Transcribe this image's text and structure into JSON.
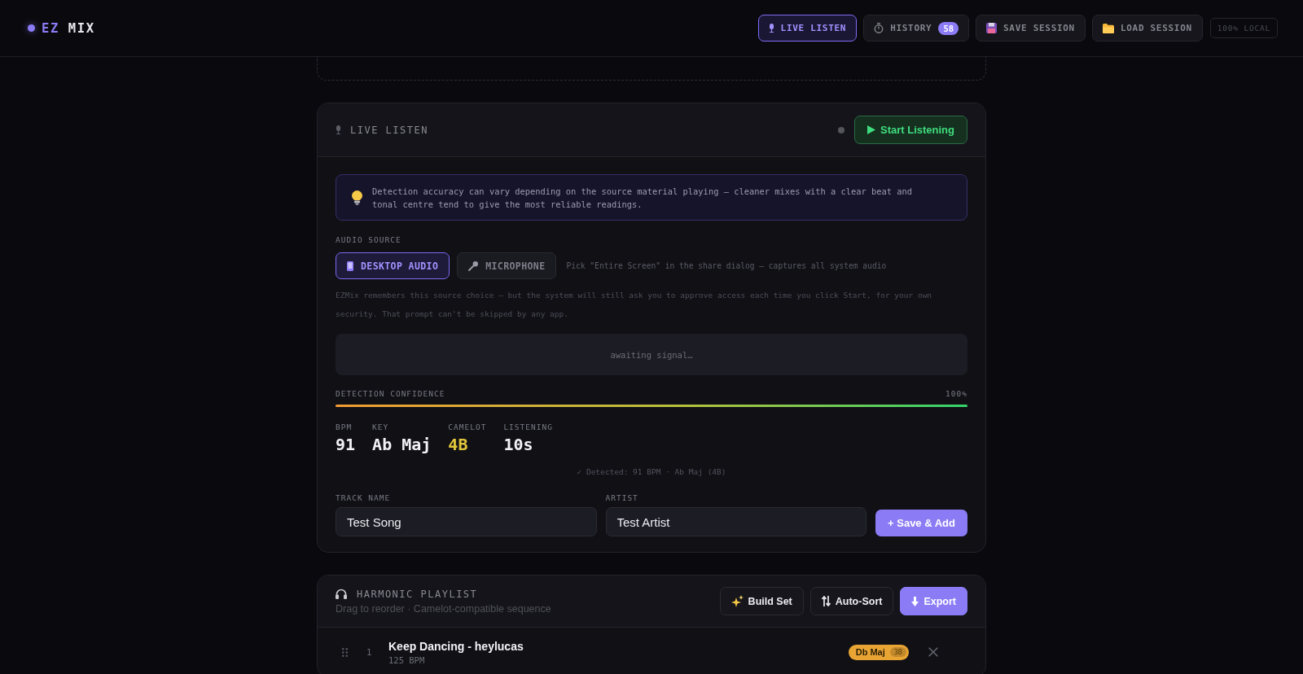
{
  "header": {
    "logo": [
      "EZ",
      "MIX"
    ],
    "nav": [
      {
        "label": "LIVE LISTEN",
        "selected": true
      },
      {
        "label": "HISTORY",
        "badge": "58",
        "selected": false
      },
      {
        "label": "SAVE SESSION",
        "selected": false
      },
      {
        "label": "LOAD SESSION",
        "selected": false
      }
    ],
    "status_chip": "100% LOCAL"
  },
  "live_listen": {
    "title": "LIVE LISTEN",
    "listening": false,
    "start_button": "Start Listening",
    "tip": "Detection accuracy can vary depending on the source material playing — cleaner mixes with a clear beat and tonal centre tend to give the most reliable readings.",
    "audio_source": {
      "label": "AUDIO SOURCE",
      "options": [
        {
          "label": "DESKTOP AUDIO",
          "selected": true
        },
        {
          "label": "MICROPHONE",
          "selected": false
        }
      ],
      "hint": "Pick \"Entire Screen\" in the share dialog — captures all system audio"
    },
    "note": "EZMix remembers this source choice — but the system will still ask you to approve access each time you click Start, for your own security. That prompt can't be skipped by any app.",
    "signal": "awaiting signal…",
    "confidence": {
      "label": "DETECTION CONFIDENCE",
      "reading": "100%",
      "level": 1
    },
    "stats": [
      {
        "label": "BPM",
        "value": "91",
        "highlighted": false
      },
      {
        "label": "KEY",
        "value": "Ab Maj",
        "highlighted": false
      },
      {
        "label": "CAMELOT",
        "value": "4B",
        "highlighted": true
      },
      {
        "label": "LISTENING",
        "value": "10s",
        "highlighted": false
      }
    ],
    "detected": "✓ Detected: 91 BPM · Ab Maj (4B)",
    "fields": [
      {
        "label": "TRACK NAME",
        "value": "Test Song"
      },
      {
        "label": "ARTIST",
        "value": "Test Artist"
      }
    ],
    "submit_button": "+ Save & Add"
  },
  "playlist": {
    "title": "HARMONIC PLAYLIST",
    "subtitle": "Drag to reorder · Camelot-compatible sequence",
    "actions": [
      {
        "label": "Build Set",
        "primary": false
      },
      {
        "label": "Auto-Sort",
        "primary": false
      },
      {
        "label": "Export",
        "primary": true
      }
    ],
    "tracks": [
      {
        "number": "1",
        "title": "Keep Dancing - heylucas",
        "bpm": "125 BPM",
        "key": "Db Maj",
        "camelot": "3B",
        "color": "#e9a534"
      }
    ]
  }
}
